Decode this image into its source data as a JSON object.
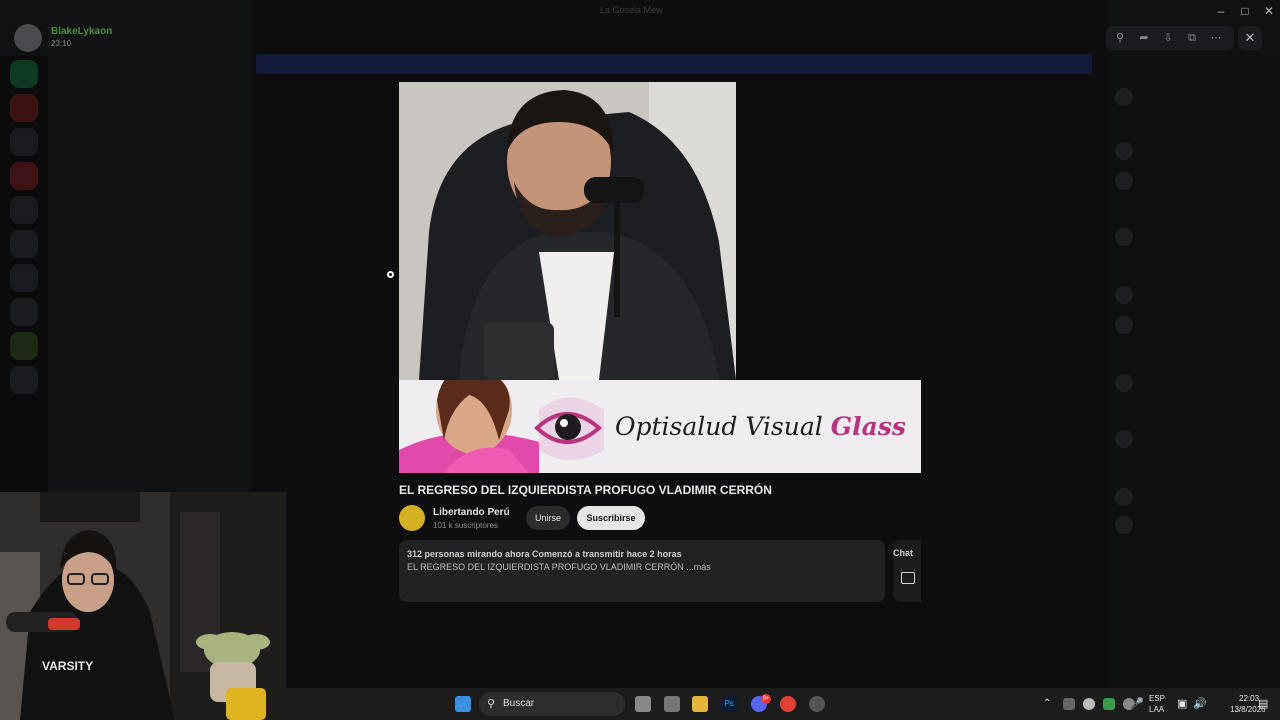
{
  "user": {
    "name": "BlakeLykaon",
    "time": "23:10"
  },
  "window": {
    "title": "La Gosela Mew"
  },
  "viewer": {
    "tools": [
      "zoom-icon",
      "forward-icon",
      "download-icon",
      "open-external-icon",
      "more-icon"
    ],
    "close_icon": "close-icon"
  },
  "screenshot": {
    "ad": {
      "brand_main": "Optisalud Visual",
      "brand_accent": "Glass",
      "accent_color": "#b8347f"
    },
    "video_title": "EL REGRESO DEL IZQUIERDISTA PROFUGO VLADIMIR CERRÓN",
    "channel": {
      "name": "Libertando Perú",
      "subscribers": "101 k suscriptores"
    },
    "buttons": {
      "join": "Unirse",
      "subscribe": "Suscribirse"
    },
    "description": {
      "meta": "312 personas mirando ahora  Comenzó a transmitir hace 2 horas",
      "text": "EL REGRESO DEL IZQUIERDISTA  PROFUGO  VLADIMIR CERRÓN ...más"
    },
    "chat_label": "Chat"
  },
  "taskbar": {
    "search_label": "Buscar",
    "language": "ESP",
    "language_sub": "LAA",
    "time": "22:03",
    "date": "13/8/2026",
    "discord_badge": "9+"
  }
}
